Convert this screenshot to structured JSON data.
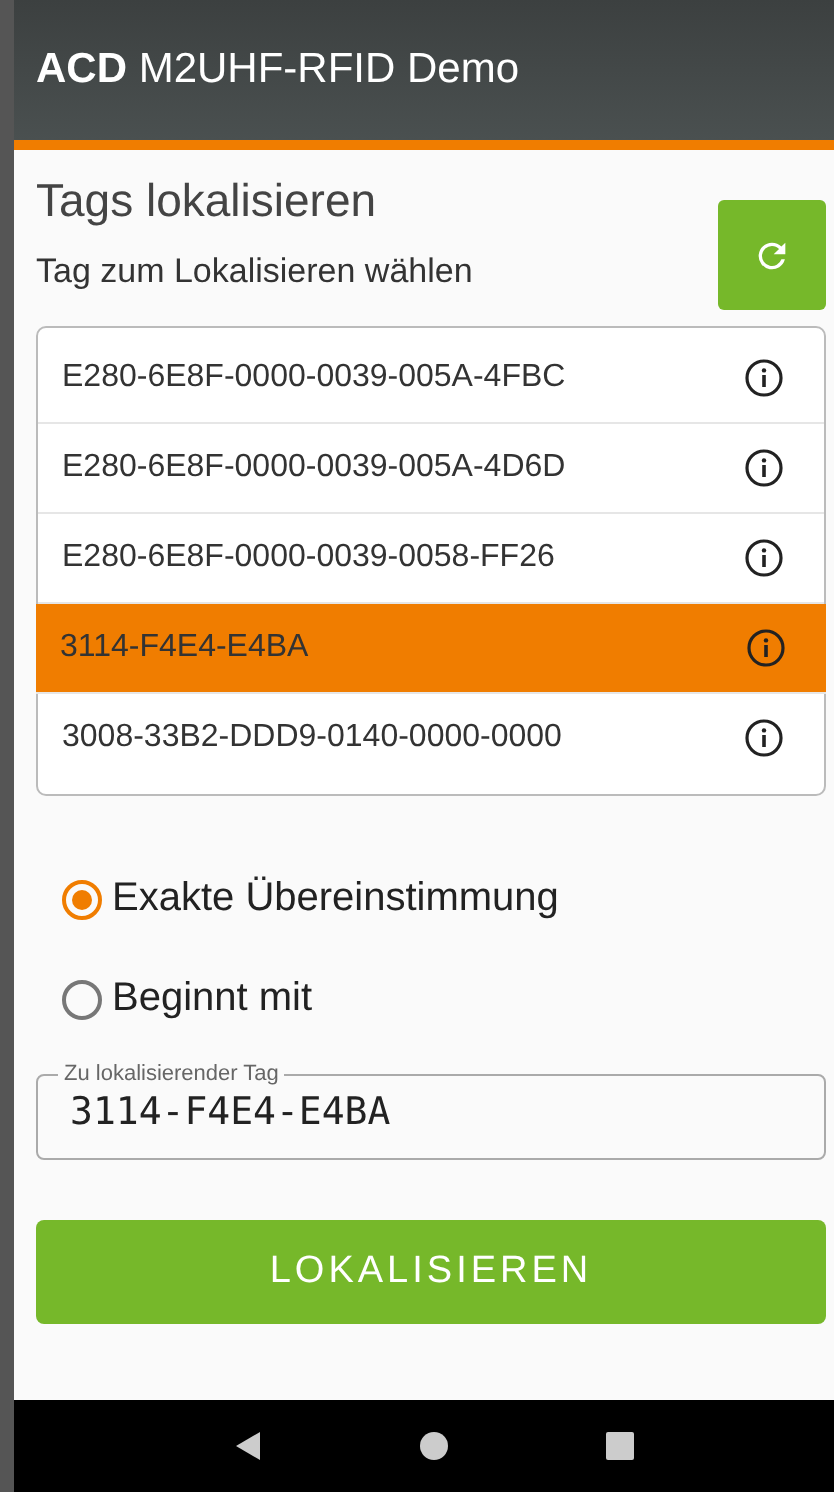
{
  "app_bar": {
    "title": "**ACD** M2UHF-RFID Demo"
  },
  "heading": "Tags lokalisieren",
  "list_label": "Tag zum Lokalisieren wählen",
  "tags": [
    {
      "id": "E280-6E8F-0000-0039-005A-4FBC",
      "selected": false
    },
    {
      "id": "E280-6E8F-0000-0039-005A-4D6D",
      "selected": false
    },
    {
      "id": "E280-6E8F-0000-0039-0058-FF26",
      "selected": false
    },
    {
      "id": "3114-F4E4-E4BA",
      "selected": true
    },
    {
      "id": "3008-33B2-DDD9-0140-0000-0000",
      "selected": false
    }
  ],
  "match_options": [
    {
      "label": "Exakte Übereinstimmung",
      "selected": true
    },
    {
      "label": "Beginnt mit",
      "selected": false
    }
  ],
  "tag_field": {
    "label": "Zu lokalisierender Tag",
    "value": "3114-F4E4-E4BA"
  },
  "locate_button": "LOKALISIEREN"
}
